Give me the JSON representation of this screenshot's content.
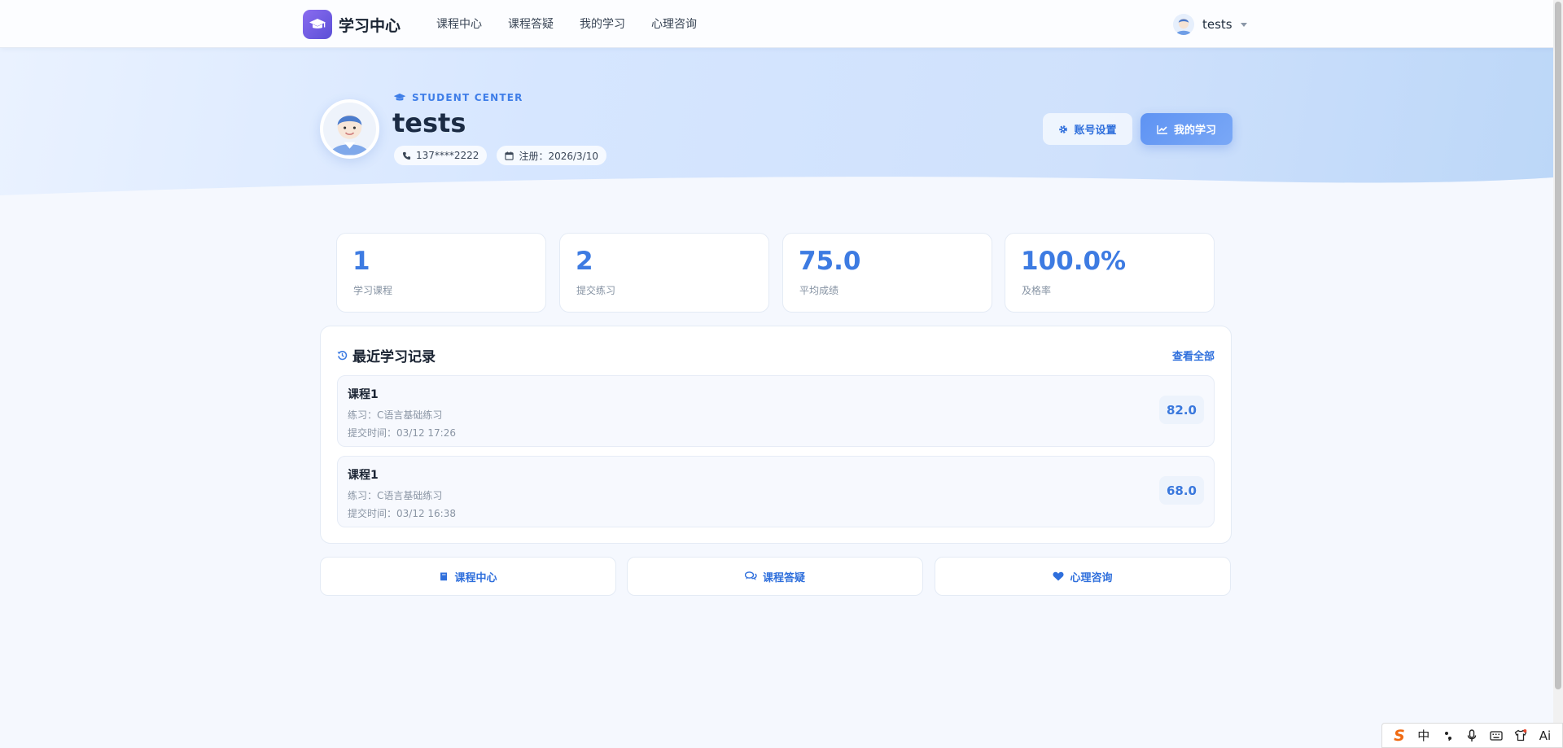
{
  "brand": {
    "title": "学习中心",
    "logo_icon": "graduation-cap-icon"
  },
  "nav": {
    "links": [
      {
        "label": "课程中心"
      },
      {
        "label": "课程答疑"
      },
      {
        "label": "我的学习"
      },
      {
        "label": "心理咨询"
      }
    ],
    "user": {
      "name": "tests"
    }
  },
  "hero": {
    "tag": "STUDENT CENTER",
    "name": "tests",
    "phone": "137****2222",
    "registered": "注册：2026/3/10",
    "settings_button": "账号设置",
    "my_learning_button": "我的学习"
  },
  "stats": [
    {
      "value": "1",
      "label": "学习课程"
    },
    {
      "value": "2",
      "label": "提交练习"
    },
    {
      "value": "75.0",
      "label": "平均成绩"
    },
    {
      "value": "100.0%",
      "label": "及格率"
    }
  ],
  "records": {
    "title": "最近学习记录",
    "view_all": "查看全部",
    "items": [
      {
        "course": "课程1",
        "practice": "练习：C语言基础练习",
        "time": "提交时间：03/12 17:26",
        "score": "82.0"
      },
      {
        "course": "课程1",
        "practice": "练习：C语言基础练习",
        "time": "提交时间：03/12 16:38",
        "score": "68.0"
      }
    ]
  },
  "quick_links": [
    {
      "label": "课程中心",
      "icon": "book-icon"
    },
    {
      "label": "课程答疑",
      "icon": "chat-bubbles-icon"
    },
    {
      "label": "心理咨询",
      "icon": "heart-icon"
    }
  ],
  "ime": {
    "logo": "S",
    "mode": "中",
    "ai": "Ai"
  },
  "colors": {
    "accent": "#3d7be2",
    "brand_gradient_start": "#8a6cf0",
    "brand_gradient_end": "#5b4fd6",
    "hero_background": "#d6e6ff",
    "page_background": "#f5f8fe"
  }
}
